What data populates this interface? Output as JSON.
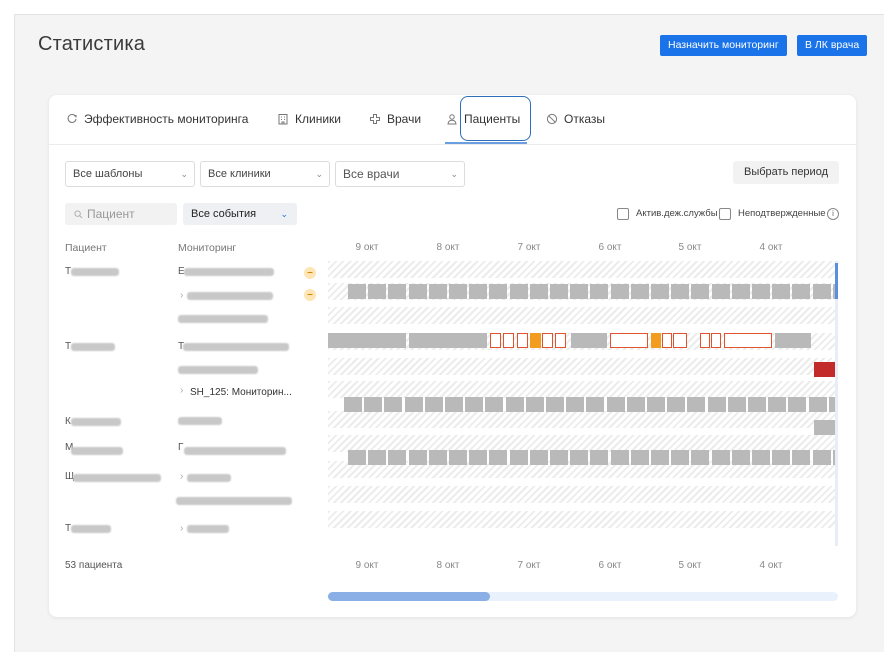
{
  "page": {
    "title": "Статистика"
  },
  "header": {
    "assign_monitoring": "Назначить мониторинг",
    "doctor_cabinet": "В ЛК врача"
  },
  "tabs": [
    {
      "label": "Эффективность мониторинга",
      "icon": "chart-refresh-icon"
    },
    {
      "label": "Клиники",
      "icon": "building-icon"
    },
    {
      "label": "Врачи",
      "icon": "medical-cross-icon"
    },
    {
      "label": "Пациенты",
      "icon": "user-icon",
      "active": true
    },
    {
      "label": "Отказы",
      "icon": "forbidden-icon"
    }
  ],
  "filters": {
    "templates": "Все шаблоны",
    "clinics": "Все клиники",
    "doctors": "Все врачи",
    "period": "Выбрать период",
    "search_placeholder": "Пациент",
    "events": "Все события",
    "active_duty": "Актив.деж.службы",
    "unconfirmed": "Неподтвержденные"
  },
  "table": {
    "col_patient": "Пациент",
    "col_monitoring": "Мониторинг",
    "dates": [
      "9 окт",
      "8 окт",
      "7 окт",
      "6 окт",
      "5 окт",
      "4 окт"
    ],
    "visible_monitoring_label": "SH_125: Мониторин...",
    "patient_initials": [
      "Т",
      "Т",
      "К",
      "М",
      "Щ",
      "Т"
    ],
    "monitoring_initials": [
      "Е",
      "Т",
      "Г"
    ]
  },
  "footer": {
    "count": "53 пациента"
  },
  "colors": {
    "accent": "#1a73e8",
    "alert": "#e0532d",
    "warning": "#f39c1f",
    "danger": "#c32b2b"
  }
}
